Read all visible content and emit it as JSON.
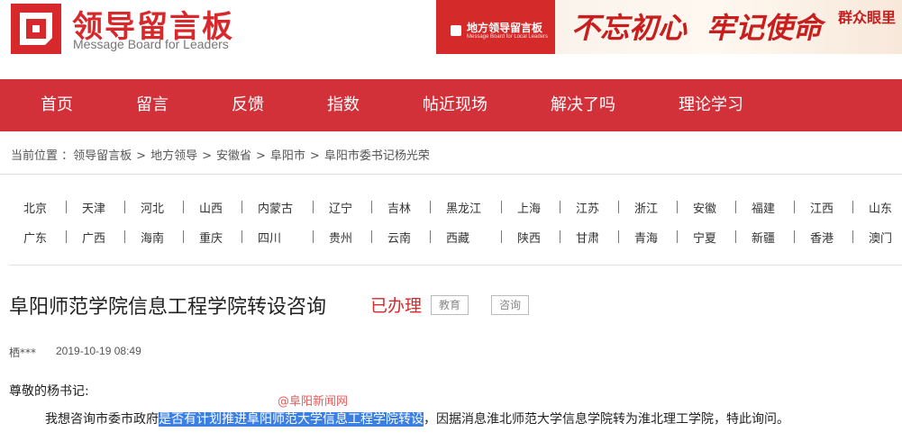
{
  "header": {
    "logo_title": "领导留言板",
    "logo_subtitle": "Message Board for Leaders",
    "banner": {
      "brand": "地方领导留言板",
      "brand_sub": "Message Board for Local Leaders",
      "slogan1": "不忘初心",
      "slogan2": "牢记使命",
      "right_text": "群众眼里"
    }
  },
  "nav": {
    "items": [
      "首页",
      "留言",
      "反馈",
      "指数",
      "帖近现场",
      "解决了吗",
      "理论学习"
    ]
  },
  "breadcrumb": {
    "prefix": "当前位置 ：",
    "items": [
      "领导留言板",
      "地方领导",
      "安徽省",
      "阜阳市",
      "阜阳市委书记杨光荣"
    ],
    "separator": ">"
  },
  "provinces": {
    "row1": [
      "北京",
      "天津",
      "河北",
      "山西",
      "内蒙古",
      "辽宁",
      "吉林",
      "黑龙江",
      "上海",
      "江苏",
      "浙江",
      "安徽",
      "福建",
      "江西",
      "山东"
    ],
    "row2": [
      "广东",
      "广西",
      "海南",
      "重庆",
      "四川",
      "贵州",
      "云南",
      "西藏",
      "陕西",
      "甘肃",
      "青海",
      "宁夏",
      "新疆",
      "香港",
      "澳门"
    ]
  },
  "message": {
    "title": "阜阳师范学院信息工程学院转设咨询",
    "status": "已办理",
    "tags": [
      "教育",
      "咨询"
    ],
    "author": "栖***",
    "date": "2019-10-19 08:49",
    "greeting": "尊敬的杨书记:",
    "body_before": "我想咨询市委市政府",
    "body_highlight": "是否有计划推进阜阳师范大学信息工程学院转设",
    "body_after": "，因据消息淮北师范大学信息学院转为淮北理工学院，特此询问。",
    "watermark": "@阜阳新闻网"
  },
  "colors": {
    "brand_red": "#d2313a",
    "status_red": "#d7282b",
    "highlight": "#3b7fe3"
  }
}
